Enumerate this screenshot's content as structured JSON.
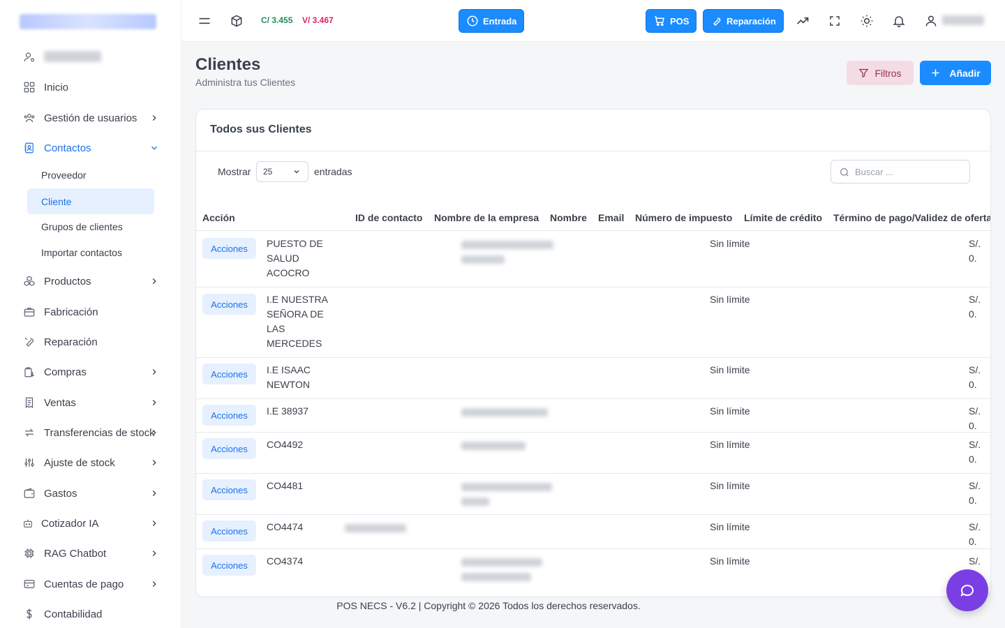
{
  "topbar": {
    "rate_buy": "C/ 3.455",
    "rate_sell": "V/ 3.467",
    "entrada_label": "Entrada",
    "pos_label": "POS",
    "reparacion_label": "Reparación"
  },
  "sidebar": {
    "items": [
      {
        "label": "Inicio",
        "icon": "grid-icon"
      },
      {
        "label": "Gestión de usuarios",
        "icon": "users-icon"
      },
      {
        "label": "Contactos",
        "icon": "contacts-icon"
      },
      {
        "label": "Productos",
        "icon": "boxes-icon"
      },
      {
        "label": "Fabricación",
        "icon": "briefcase-icon"
      },
      {
        "label": "Reparación",
        "icon": "wrench-icon"
      },
      {
        "label": "Compras",
        "icon": "purchase-icon"
      },
      {
        "label": "Ventas",
        "icon": "receipt-icon"
      },
      {
        "label": "Transferencias de stock",
        "icon": "transfer-icon"
      },
      {
        "label": "Ajuste de stock",
        "icon": "sliders-icon"
      },
      {
        "label": "Gastos",
        "icon": "wallet-icon"
      },
      {
        "label": "Cotizador IA",
        "icon": "robot-icon"
      },
      {
        "label": "RAG Chatbot",
        "icon": "chip-icon"
      },
      {
        "label": "Cuentas de pago",
        "icon": "card-icon"
      },
      {
        "label": "Contabilidad",
        "icon": "dollar-icon"
      }
    ],
    "contact_sub": [
      "Proveedor",
      "Cliente",
      "Grupos de clientes",
      "Importar contactos"
    ]
  },
  "page": {
    "title": "Clientes",
    "subtitle": "Administra tus Clientes",
    "filter_label": "Filtros",
    "add_label": "Añadir"
  },
  "card": {
    "title": "Todos sus Clientes",
    "show_label": "Mostrar",
    "page_length": "25",
    "entries_label": "entradas",
    "search_placeholder": "Buscar ..."
  },
  "table": {
    "columns": [
      "Acción",
      "ID de contacto",
      "Nombre de la empresa",
      "Nombre",
      "Email",
      "Número de impuesto",
      "Límite de crédito",
      "Término de pago/Validez de oferta"
    ],
    "action_label": "Acciones",
    "rows": [
      {
        "name": [
          "PUESTO DE",
          "SALUD",
          "ACOCRO"
        ],
        "credit": "Sin límite",
        "balance": "S/. 0."
      },
      {
        "name": [
          "I.E NUESTRA",
          "SEÑORA DE",
          "LAS",
          "MERCEDES"
        ],
        "credit": "Sin límite",
        "balance": "S/. 0."
      },
      {
        "name": [
          "I.E ISAAC",
          "NEWTON"
        ],
        "credit": "Sin límite",
        "balance": "S/. 0."
      },
      {
        "name": [
          "I.E 38937"
        ],
        "credit": "Sin límite",
        "balance": "S/. 0."
      },
      {
        "name": [
          "CO4492"
        ],
        "credit": "Sin límite",
        "balance": "S/. 0."
      },
      {
        "name": [
          "CO4481"
        ],
        "credit": "Sin límite",
        "balance": "S/. 0."
      },
      {
        "name": [
          "CO4474"
        ],
        "credit": "Sin límite",
        "balance": "S/. 0."
      },
      {
        "name": [
          "CO4374"
        ],
        "credit": "Sin límite",
        "balance": "S/. 0."
      }
    ]
  },
  "footer": {
    "text": "POS NECS - V6.2 | Copyright © 2026 Todos los derechos reservados."
  },
  "colors": {
    "accent": "#1a8cff",
    "active_text": "#1a73e8",
    "rate_buy": "#1e8e5a",
    "rate_sell": "#e0245e",
    "chat": "#7a3fe4"
  }
}
